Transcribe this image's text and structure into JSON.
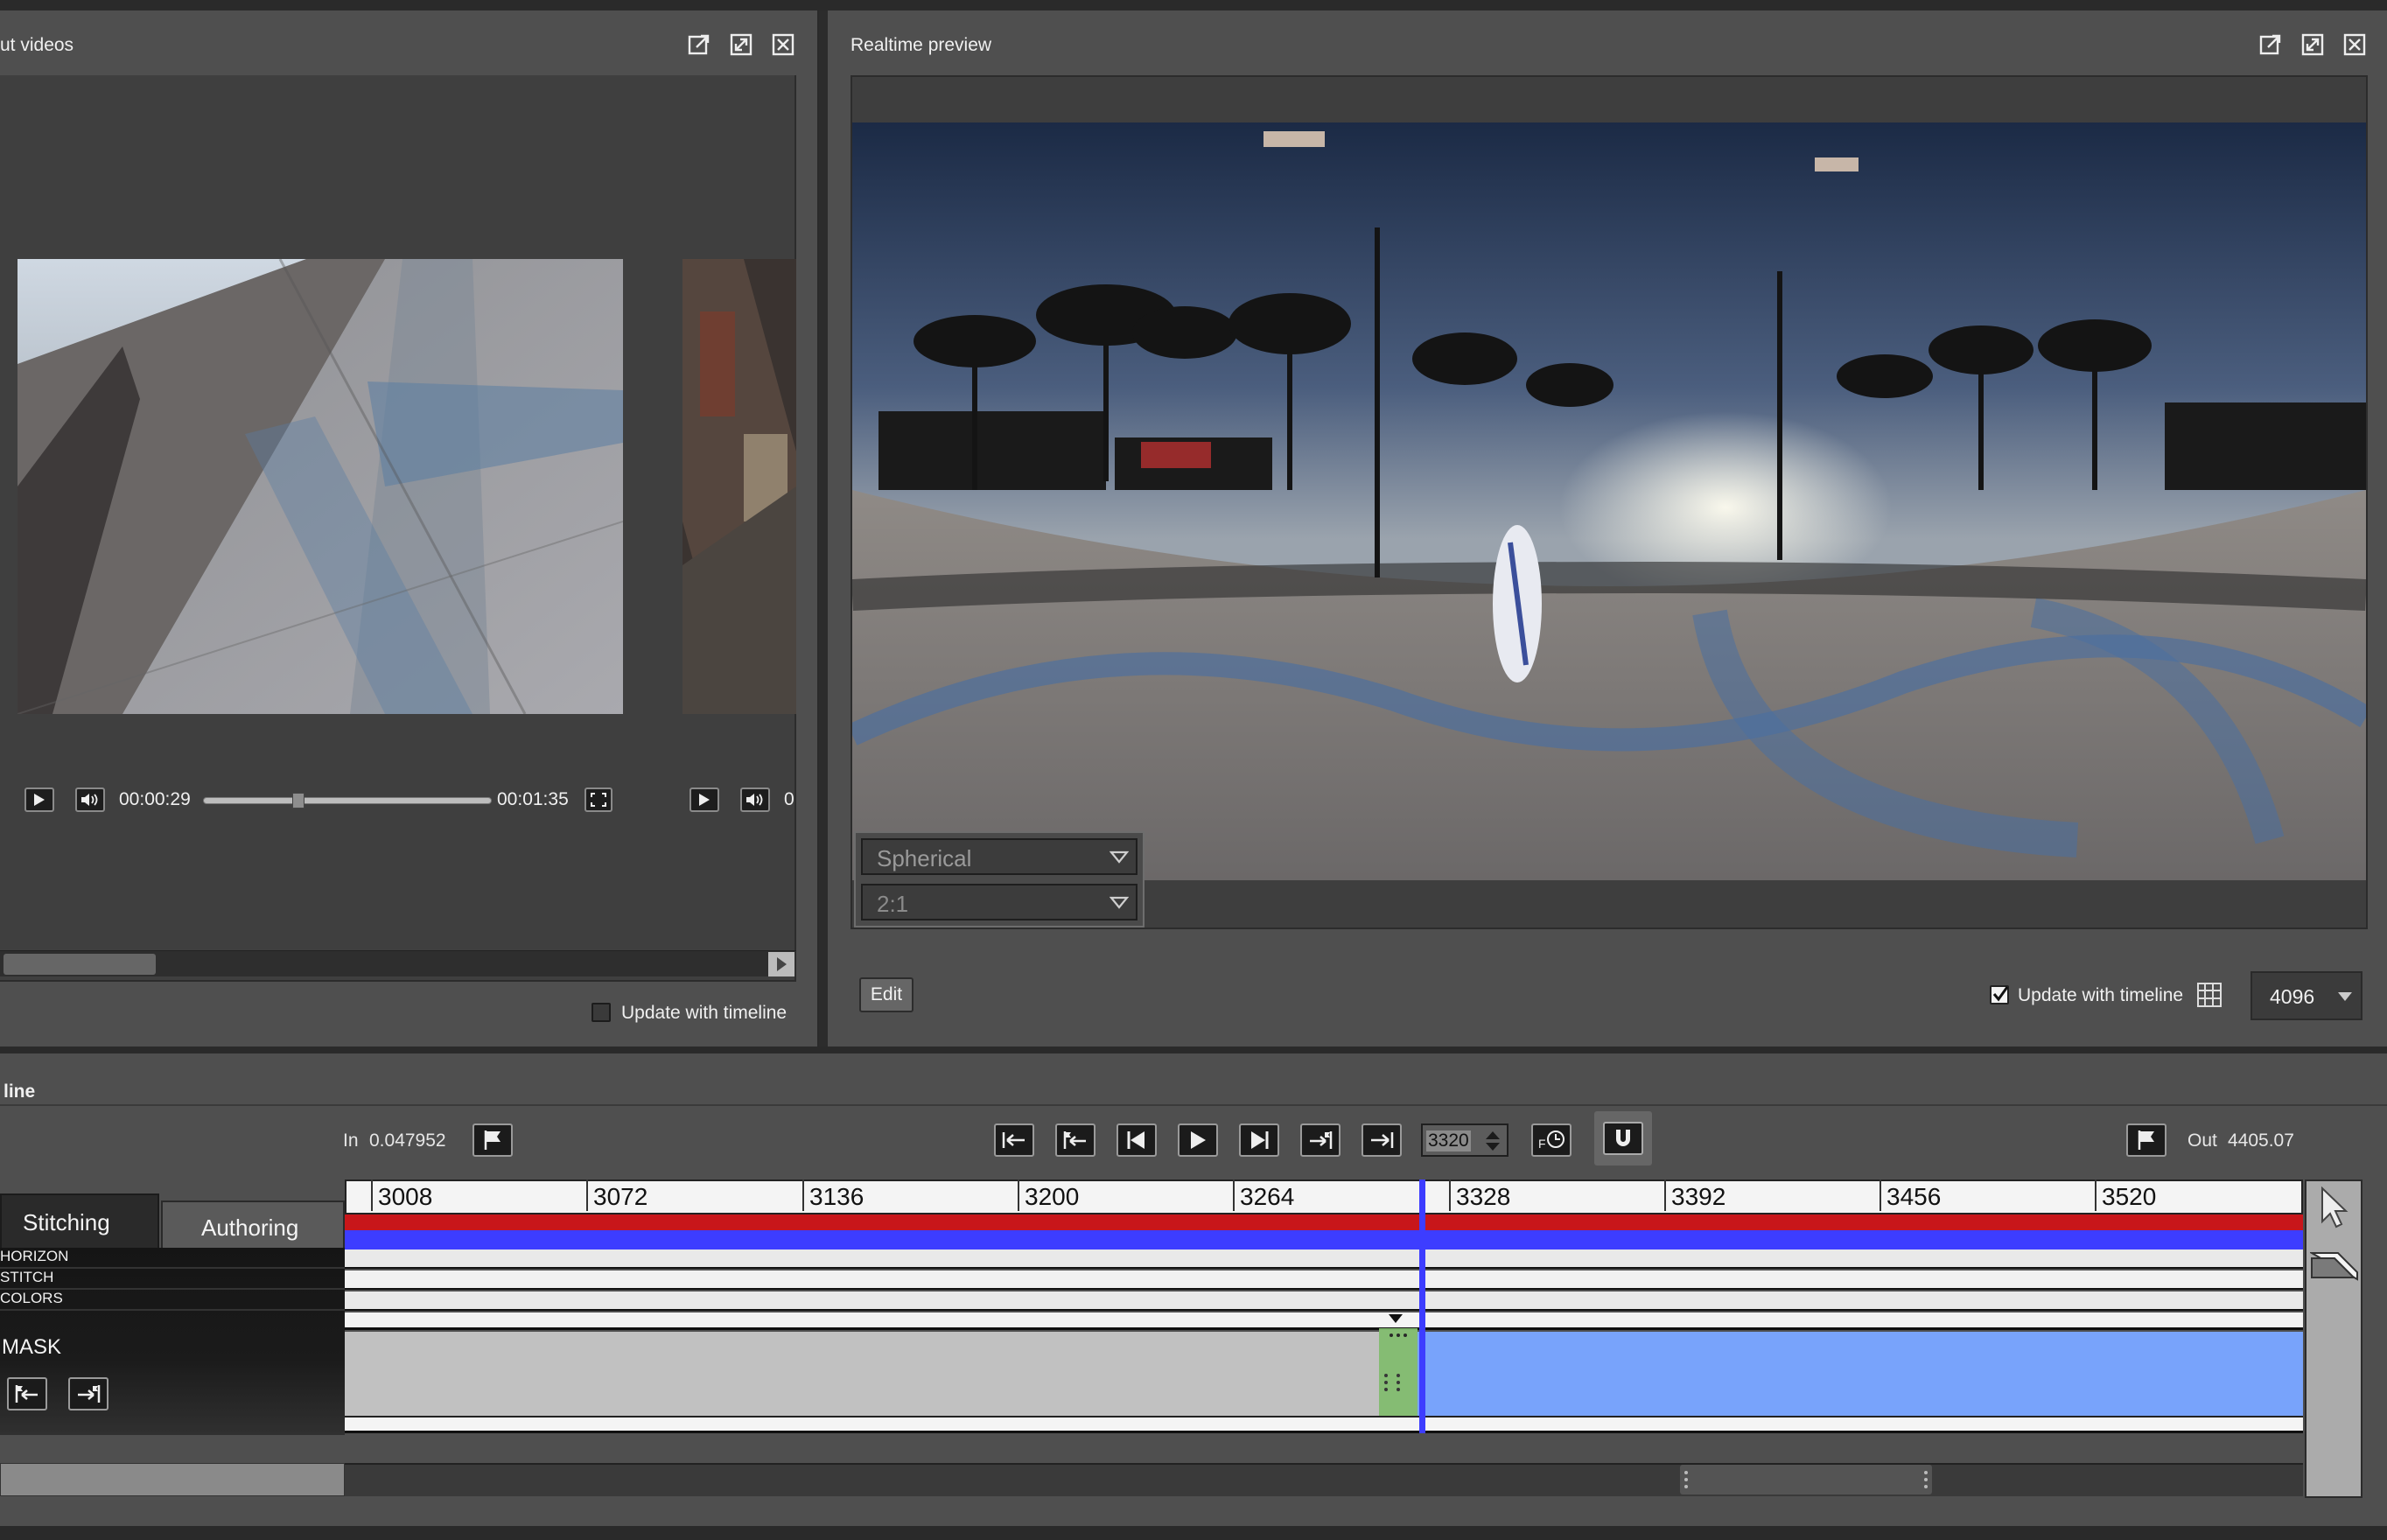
{
  "input_panel": {
    "title": "ut videos",
    "time_current": "00:00:29",
    "time_total": "00:01:35",
    "time_partial": "0",
    "update_label": "Update with timeline",
    "update_checked": false,
    "scrub_progress": 0.33
  },
  "preview_panel": {
    "title": "Realtime preview",
    "projection": "Spherical",
    "aspect": "2:1",
    "edit_label": "Edit",
    "update_label": "Update with timeline",
    "update_checked": true,
    "resolution": "4096"
  },
  "timeline": {
    "title": "line",
    "in_label": "In",
    "in_value": "0.047952",
    "out_label": "Out",
    "out_value": "4405.07",
    "frame": "3320",
    "tabs": [
      "Stitching",
      "Authoring"
    ],
    "active_tab": "Stitching",
    "tracks": [
      "HORIZON",
      "STITCH",
      "COLORS"
    ],
    "mask_label": "MASK",
    "ruler": [
      "3008",
      "3072",
      "3136",
      "3200",
      "3264",
      "3328",
      "3392",
      "3456",
      "3520"
    ]
  },
  "colors": {
    "accent_blue": "#3d3dff",
    "accent_red": "#c8161a",
    "mask_blue": "#78a3fb",
    "mask_gray": "#c1c1c1",
    "keyframe_green": "#8fd07a"
  }
}
